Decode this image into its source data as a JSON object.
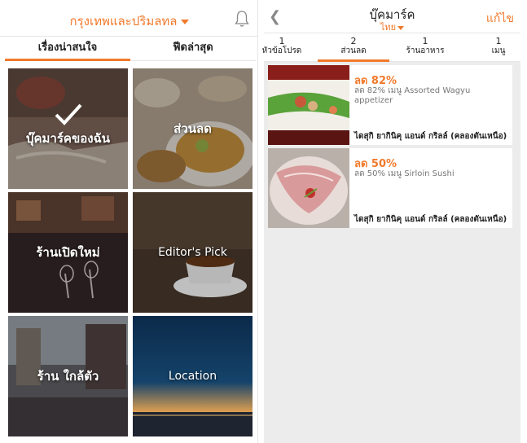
{
  "left": {
    "location": "กรุงเทพและปริมลทล",
    "tabs": [
      "เรื่องน่าสนใจ",
      "ฟีดล่าสุด"
    ],
    "tiles": [
      "บุ๊คมาร์คของฉัน",
      "ส่วนลด",
      "ร้านเปิดใหม่",
      "Editor's Pick",
      "ร้าน ใกล้ตัว",
      "Location"
    ]
  },
  "right": {
    "title": "บุ๊คมาร์ค",
    "language": "ไทย",
    "edit": "แก้ไข",
    "tabs": [
      {
        "count": "1",
        "label": "หัวข้อโปรด"
      },
      {
        "count": "2",
        "label": "ส่วนลด"
      },
      {
        "count": "1",
        "label": "ร้านอาหาร"
      },
      {
        "count": "1",
        "label": "เมนู"
      }
    ],
    "cards": [
      {
        "discount": "ลด 82%",
        "desc": "ลด 82% เมนู Assorted Wagyu appetizer",
        "venue": "ไดสุกิ ยากินิคุ แอนด์ กริลล์ (คลองตันเหนือ)"
      },
      {
        "discount": "ลด 50%",
        "desc": "ลด 50% เมนู Sirloin Sushi",
        "venue": "ไดสุกิ ยากินิคุ แอนด์ กริลล์ (คลองตันเหนือ)"
      }
    ]
  },
  "colors": {
    "accent": "#f07a2c"
  }
}
